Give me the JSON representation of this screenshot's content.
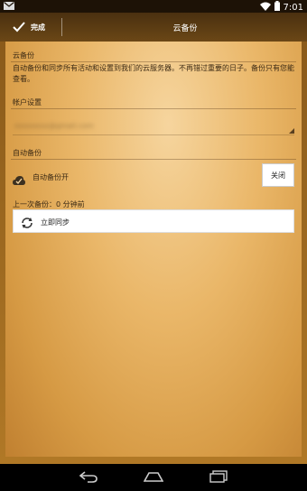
{
  "status_bar": {
    "time": "7:01",
    "icons": [
      "mail-icon",
      "wifi-icon",
      "battery-icon"
    ]
  },
  "action_bar": {
    "done_label": "完成",
    "title": "云备份"
  },
  "cloud_section": {
    "header": "云备份",
    "description": "自动备份和同步所有活动和设置到我们的云服务器。不再错过重要的日子。备份只有您能查看。"
  },
  "account_section": {
    "header": "帐户设置",
    "account_value": "xxxxxxxx@gmail.com"
  },
  "auto_backup_section": {
    "header": "自动备份",
    "toggle_label": "自动备份开",
    "toggle_button": "关闭",
    "last_backup": "上一次备份：0 分钟前",
    "sync_button": "立即同步"
  },
  "colors": {
    "card_center": "#f6d59e",
    "card_edge": "#c08030",
    "text": "#3c2a14"
  }
}
